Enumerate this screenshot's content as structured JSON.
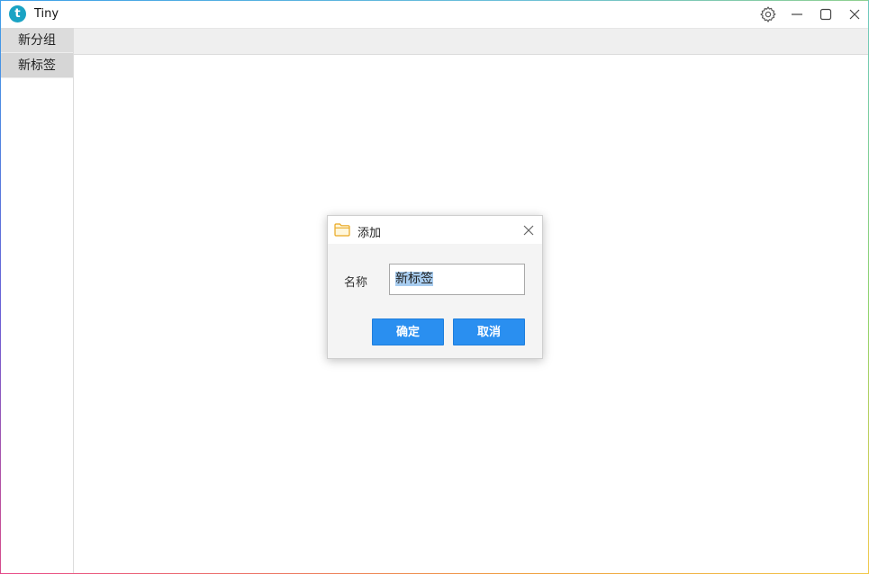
{
  "window": {
    "title": "Tiny",
    "logo_letter": "t"
  },
  "titlebar": {
    "icons": [
      "gear-icon",
      "minimize-icon",
      "maximize-icon",
      "close-icon"
    ]
  },
  "sidebar": {
    "items": [
      {
        "label": "新分组"
      },
      {
        "label": "新标签"
      }
    ]
  },
  "dialog": {
    "title": "添加",
    "field_label": "名称",
    "field_value": "新标签",
    "ok_label": "确定",
    "cancel_label": "取消"
  },
  "colors": {
    "accent": "#2a8ff0",
    "logo": "#1aa3c4",
    "folder": "#f2b632"
  }
}
